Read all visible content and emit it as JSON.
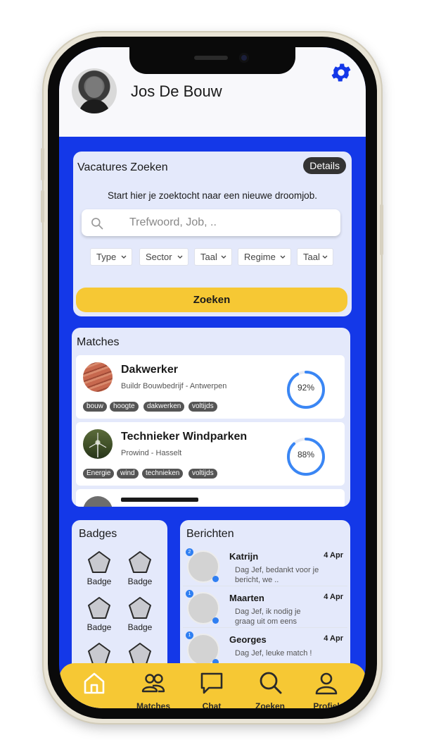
{
  "header": {
    "user_name": "Jos De Bouw"
  },
  "search": {
    "title": "Vacatures Zoeken",
    "details_label": "Details",
    "subtitle": "Start hier je zoektocht naar een nieuwe droomjob.",
    "placeholder": "Trefwoord, Job, ..",
    "filters": [
      "Type",
      "Sector",
      "Taal",
      "Regime",
      "Taal"
    ],
    "submit_label": "Zoeken"
  },
  "matches": {
    "title": "Matches",
    "items": [
      {
        "title": "Dakwerker",
        "subtitle": "Buildr Bouwbedrijf - Antwerpen",
        "tags": [
          "bouw",
          "hoogte",
          "dakwerken",
          "voltijds"
        ],
        "score": "92%",
        "score_value": 0.92
      },
      {
        "title": "Technieker Windparken",
        "subtitle": "Prowind - Hasselt",
        "tags": [
          "Energie",
          "wind",
          "technieken",
          "voltijds"
        ],
        "score": "88%",
        "score_value": 0.88
      }
    ]
  },
  "badges": {
    "title": "Badges",
    "items": [
      "Badge",
      "Badge",
      "Badge",
      "Badge"
    ]
  },
  "messages": {
    "title": "Berichten",
    "items": [
      {
        "name": "Katrijn",
        "date": "4 Apr",
        "text": "Dag Jef, bedankt voor je bericht, we ..",
        "count": "2"
      },
      {
        "name": "Maarten",
        "date": "4 Apr",
        "text": "Dag Jef, ik nodig je graag uit om eens",
        "count": "1"
      },
      {
        "name": "Georges",
        "date": "4 Apr",
        "text": "Dag Jef, leuke match !",
        "count": "1"
      }
    ]
  },
  "tabbar": {
    "items": [
      {
        "label": "",
        "icon": "home-icon"
      },
      {
        "label": "Matches",
        "icon": "users-icon"
      },
      {
        "label": "Chat",
        "icon": "chat-icon"
      },
      {
        "label": "Zoeken",
        "icon": "search-icon"
      },
      {
        "label": "Profiel",
        "icon": "profile-icon"
      }
    ]
  },
  "colors": {
    "accent": "#1438e8",
    "yellow": "#f6c834",
    "card": "#e4e9fb",
    "ring": "#3a86f4"
  }
}
